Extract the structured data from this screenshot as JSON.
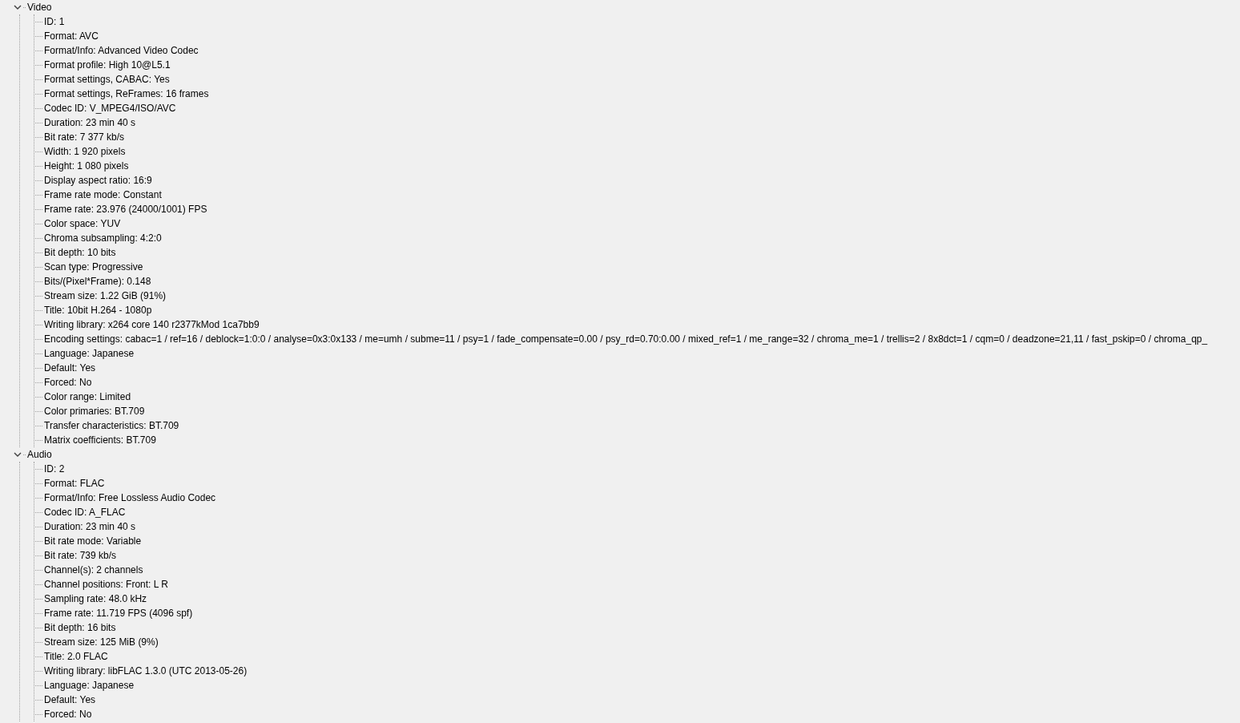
{
  "tree": [
    {
      "label": "Video",
      "expanded": true,
      "children": [
        "ID: 1",
        "Format: AVC",
        "Format/Info: Advanced Video Codec",
        "Format profile: High 10@L5.1",
        "Format settings, CABAC: Yes",
        "Format settings, ReFrames: 16 frames",
        "Codec ID: V_MPEG4/ISO/AVC",
        "Duration: 23 min 40 s",
        "Bit rate: 7 377 kb/s",
        "Width: 1 920 pixels",
        "Height: 1 080 pixels",
        "Display aspect ratio: 16:9",
        "Frame rate mode: Constant",
        "Frame rate: 23.976 (24000/1001) FPS",
        "Color space: YUV",
        "Chroma subsampling: 4:2:0",
        "Bit depth: 10 bits",
        "Scan type: Progressive",
        "Bits/(Pixel*Frame): 0.148",
        "Stream size: 1.22 GiB (91%)",
        "Title: 10bit H.264 - 1080p",
        "Writing library: x264 core 140 r2377kMod 1ca7bb9",
        "Encoding settings: cabac=1 / ref=16 / deblock=1:0:0 / analyse=0x3:0x133 / me=umh / subme=11 / psy=1 / fade_compensate=0.00 / psy_rd=0.70:0.00 / mixed_ref=1 / me_range=32 / chroma_me=1 / trellis=2 / 8x8dct=1 / cqm=0 / deadzone=21,11 / fast_pskip=0 / chroma_qp_",
        "Language: Japanese",
        "Default: Yes",
        "Forced: No",
        "Color range: Limited",
        "Color primaries: BT.709",
        "Transfer characteristics: BT.709",
        "Matrix coefficients: BT.709"
      ]
    },
    {
      "label": "Audio",
      "expanded": true,
      "children": [
        "ID: 2",
        "Format: FLAC",
        "Format/Info: Free Lossless Audio Codec",
        "Codec ID: A_FLAC",
        "Duration: 23 min 40 s",
        "Bit rate mode: Variable",
        "Bit rate: 739 kb/s",
        "Channel(s): 2 channels",
        "Channel positions: Front: L R",
        "Sampling rate: 48.0 kHz",
        "Frame rate: 11.719 FPS (4096 spf)",
        "Bit depth: 16 bits",
        "Stream size: 125 MiB (9%)",
        "Title: 2.0 FLAC",
        "Writing library: libFLAC 1.3.0 (UTC 2013-05-26)",
        "Language: Japanese",
        "Default: Yes",
        "Forced: No"
      ]
    }
  ]
}
